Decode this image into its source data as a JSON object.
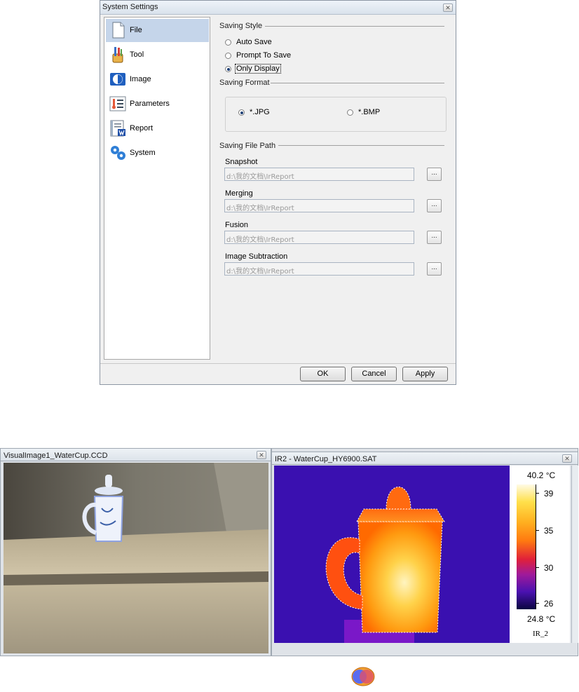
{
  "dialog": {
    "title": "System Settings",
    "close_glyph": "✕",
    "nav": [
      {
        "label": "File",
        "icon": "document-icon",
        "selected": true
      },
      {
        "label": "Tool",
        "icon": "tools-icon",
        "selected": false
      },
      {
        "label": "Image",
        "icon": "contrast-icon",
        "selected": false
      },
      {
        "label": "Parameters",
        "icon": "thermometer-list-icon",
        "selected": false
      },
      {
        "label": "Report",
        "icon": "report-icon",
        "selected": false
      },
      {
        "label": "System",
        "icon": "gears-icon",
        "selected": false
      }
    ],
    "saving_style": {
      "title": "Saving Style",
      "options": [
        {
          "label": "Auto Save",
          "checked": false
        },
        {
          "label": "Prompt To Save",
          "checked": false
        },
        {
          "label": "Only Display",
          "checked": true
        }
      ]
    },
    "saving_format": {
      "title": "Saving Format",
      "options": [
        {
          "label": "*.JPG",
          "checked": true
        },
        {
          "label": "*.BMP",
          "checked": false
        }
      ]
    },
    "saving_path": {
      "title": "Saving File Path",
      "browse_label": "...",
      "fields": [
        {
          "label": "Snapshot",
          "value": "d:\\我的文档\\IrReport"
        },
        {
          "label": "Merging",
          "value": "d:\\我的文档\\IrReport"
        },
        {
          "label": "Fusion",
          "value": "d:\\我的文档\\IrReport"
        },
        {
          "label": "Image Subtraction",
          "value": "d:\\我的文档\\IrReport"
        }
      ]
    },
    "buttons": {
      "ok": "OK",
      "cancel": "Cancel",
      "apply": "Apply"
    }
  },
  "visual_window": {
    "title": "VisualImage1_WaterCup.CCD",
    "close_glyph": "✕"
  },
  "ir_window": {
    "title": "IR2 - WaterCup_HY6900.SAT",
    "close_glyph": "✕",
    "scale": {
      "max_label": "40.2 °C",
      "min_label": "24.8 °C",
      "ticks": [
        "39",
        "35",
        "30",
        "26"
      ],
      "palette_name": "IR_2"
    }
  },
  "colors": {
    "selected_nav": "#c5d5ea",
    "ir_background": "#3a10b0"
  }
}
